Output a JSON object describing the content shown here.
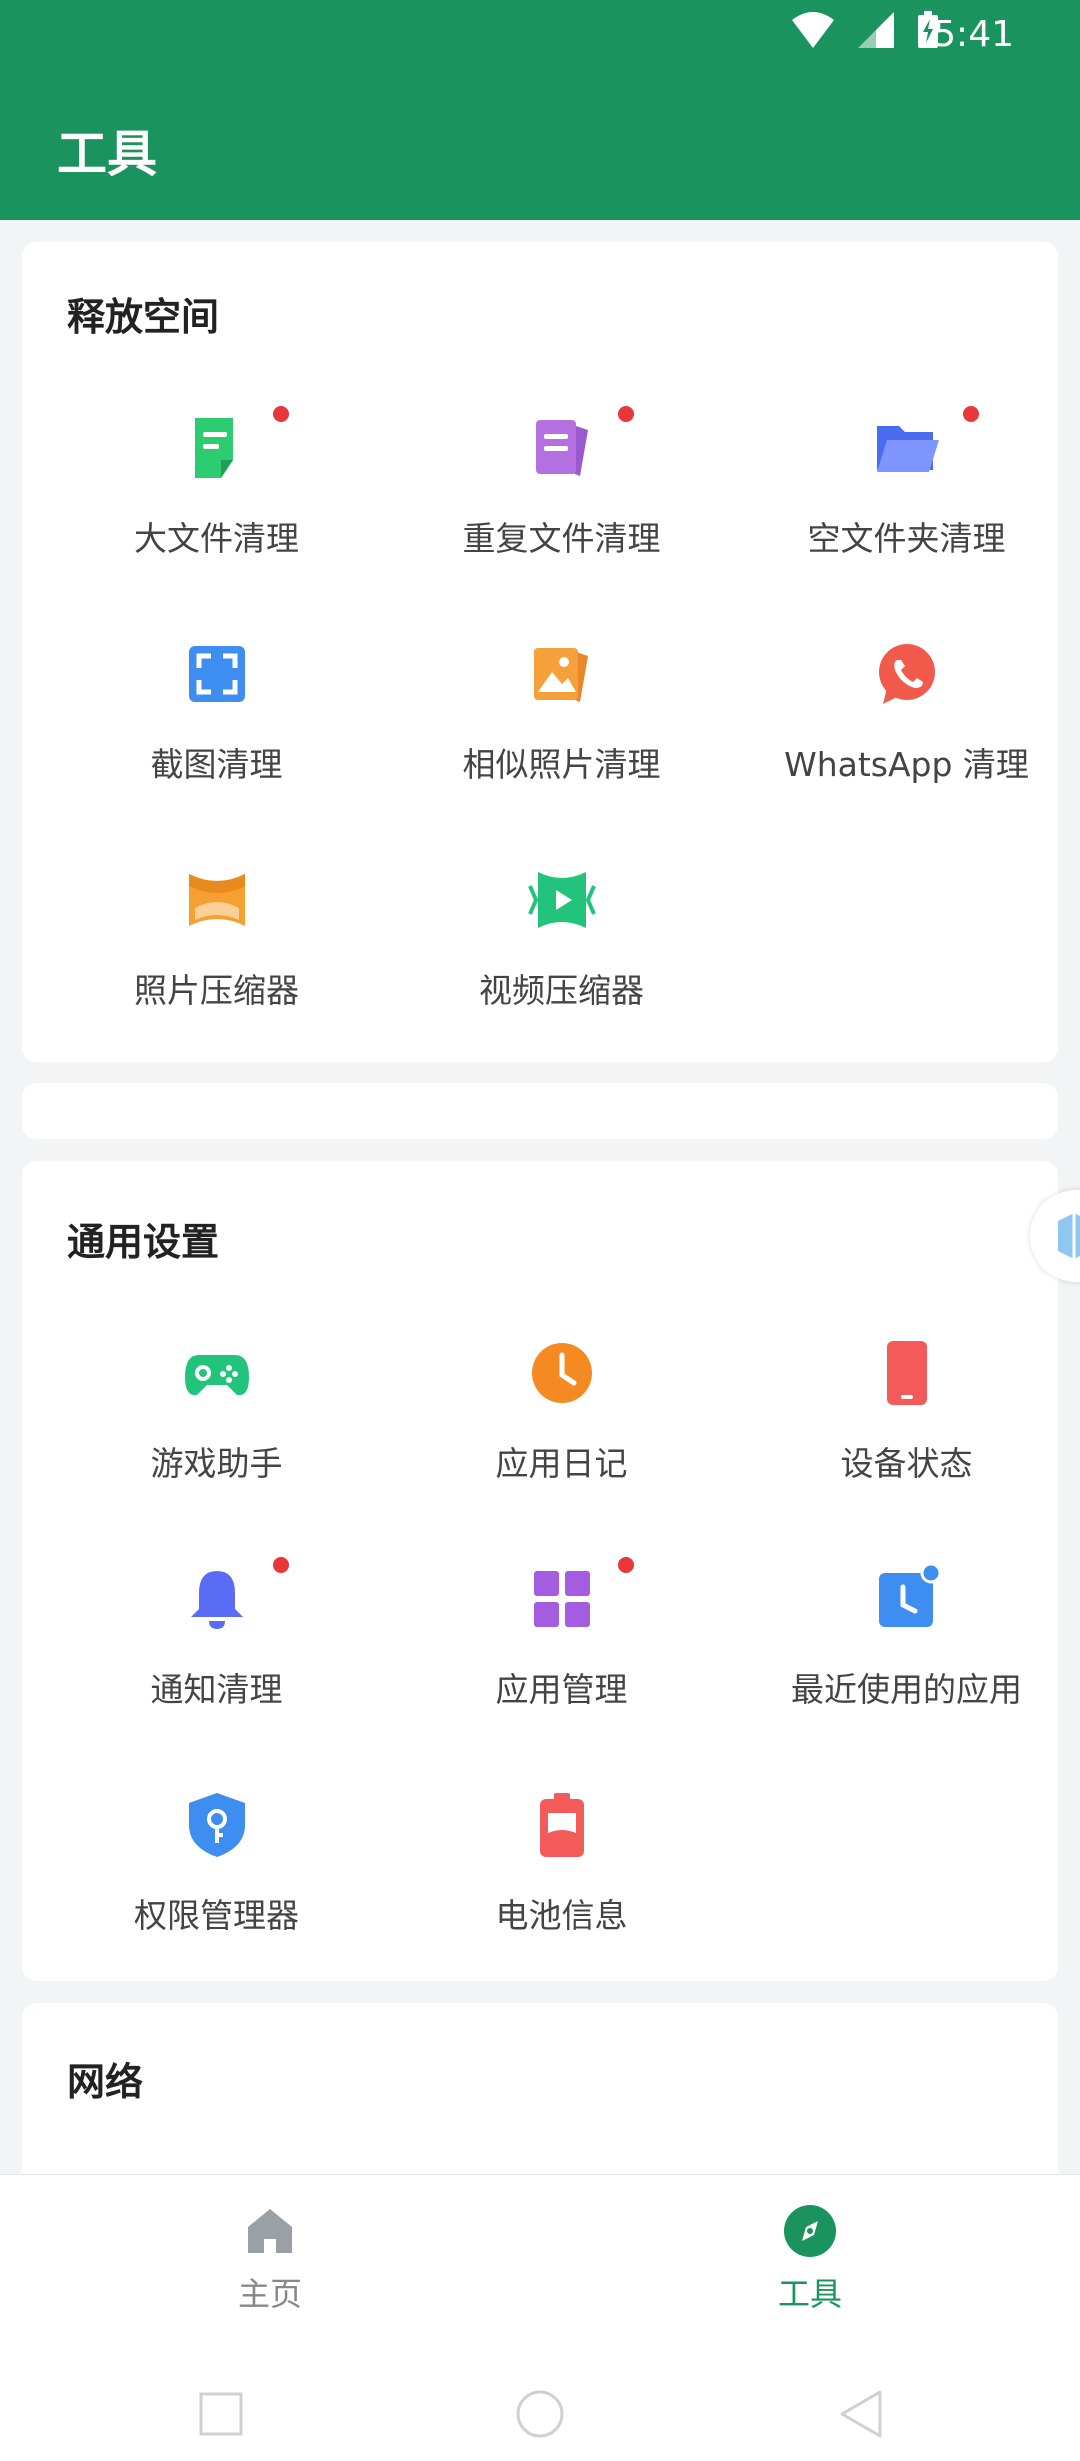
{
  "status_bar": {
    "time": "5:41"
  },
  "app_bar": {
    "title": "工具"
  },
  "sections": {
    "free_space": {
      "title": "释放空间",
      "items": [
        {
          "label": "大文件清理",
          "icon": "large-file-icon",
          "badge": true
        },
        {
          "label": "重复文件清理",
          "icon": "duplicate-file-icon",
          "badge": true
        },
        {
          "label": "空文件夹清理",
          "icon": "empty-folder-icon",
          "badge": true
        },
        {
          "label": "截图清理",
          "icon": "screenshot-icon",
          "badge": false
        },
        {
          "label": "相似照片清理",
          "icon": "similar-photo-icon",
          "badge": false
        },
        {
          "label": "WhatsApp 清理",
          "icon": "whatsapp-icon",
          "badge": false
        },
        {
          "label": "照片压缩器",
          "icon": "photo-compress-icon",
          "badge": false
        },
        {
          "label": "视频压缩器",
          "icon": "video-compress-icon",
          "badge": false
        }
      ]
    },
    "general": {
      "title": "通用设置",
      "items": [
        {
          "label": "游戏助手",
          "icon": "gamepad-icon",
          "badge": false
        },
        {
          "label": "应用日记",
          "icon": "clock-icon",
          "badge": false
        },
        {
          "label": "设备状态",
          "icon": "phone-icon",
          "badge": false
        },
        {
          "label": "通知清理",
          "icon": "bell-icon",
          "badge": true
        },
        {
          "label": "应用管理",
          "icon": "app-grid-icon",
          "badge": true
        },
        {
          "label": "最近使用的应用",
          "icon": "recent-apps-icon",
          "badge": false
        },
        {
          "label": "权限管理器",
          "icon": "shield-key-icon",
          "badge": false
        },
        {
          "label": "电池信息",
          "icon": "battery-icon",
          "badge": false
        }
      ]
    },
    "network": {
      "title": "网络"
    }
  },
  "bottom_nav": {
    "home": {
      "label": "主页",
      "icon": "home-icon",
      "active": false
    },
    "tools": {
      "label": "工具",
      "icon": "compass-icon",
      "active": true
    }
  },
  "colors": {
    "brand": "#1a935e",
    "badge": "#e8363a"
  }
}
